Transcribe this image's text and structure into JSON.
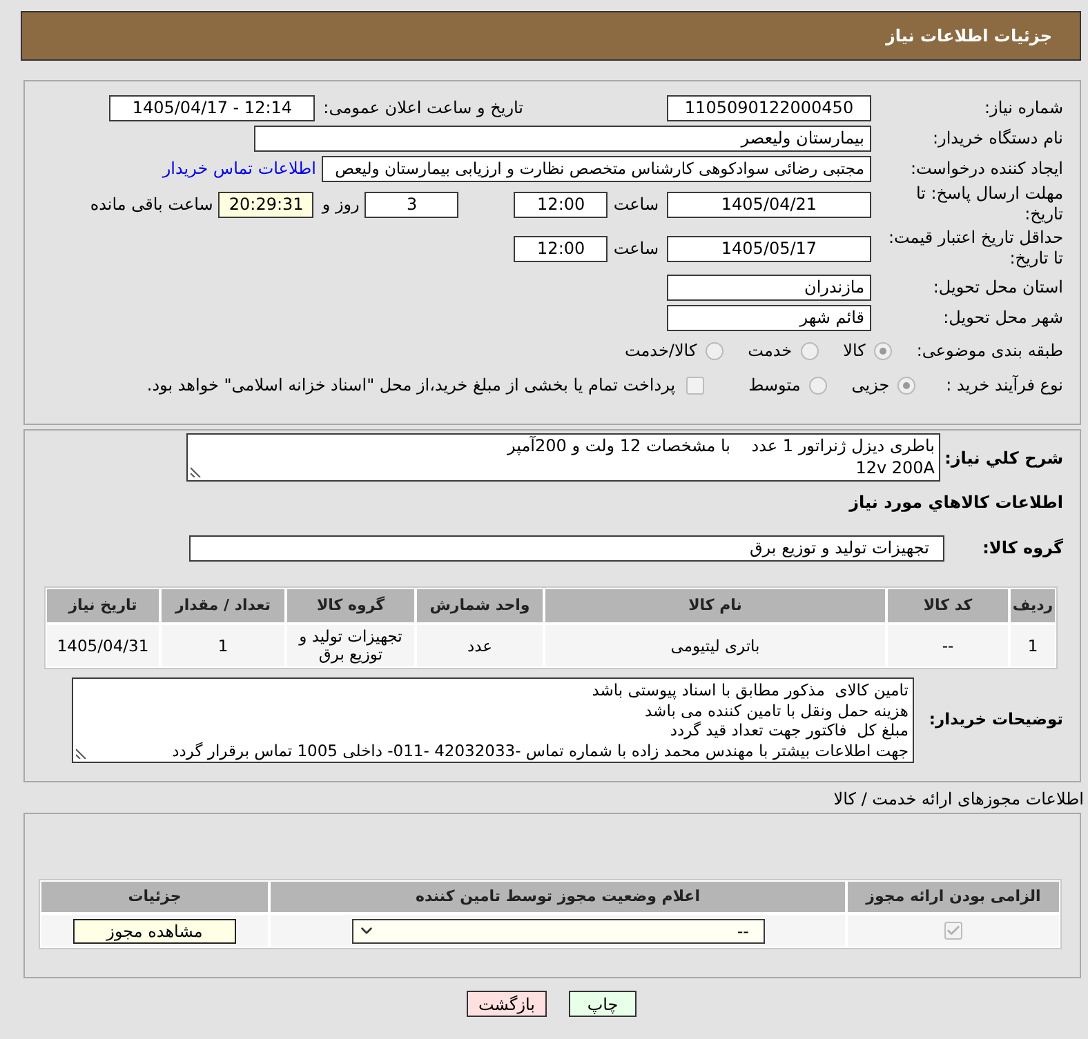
{
  "header": {
    "title": "جزئیات اطلاعات نیاز"
  },
  "need_details": {
    "need_number": {
      "label": "شماره نیاز:",
      "value": "1105090122000450"
    },
    "announcement": {
      "label": "تاریخ و ساعت اعلان عمومی:",
      "value": "1405/04/17 - 12:14"
    },
    "buyer_org": {
      "label": "نام دستگاه خریدار:",
      "value": "بیمارستان ولیعصر"
    },
    "requester": {
      "label": "ایجاد کننده درخواست:",
      "value": "مجتبی رضائی سوادکوهی کارشناس متخصص نظارت و ارزیابی بیمارستان ولیعص",
      "contact_link": "اطلاعات تماس خریدار"
    },
    "response_deadline": {
      "label": "مهلت ارسال پاسخ: تا تاریخ:",
      "date": "1405/04/21",
      "time_label": "ساعت",
      "time": "12:00",
      "days": "3",
      "days_label": "روز و",
      "remaining": "20:29:31",
      "remaining_label": "ساعت باقی مانده"
    },
    "price_validity": {
      "label": "حداقل تاریخ اعتبار قیمت: تا تاریخ:",
      "date": "1405/05/17",
      "time_label": "ساعت",
      "time": "12:00"
    },
    "delivery_province": {
      "label": "استان محل تحویل:",
      "value": "مازندران"
    },
    "delivery_city": {
      "label": "شهر محل تحویل:",
      "value": "قائم شهر"
    },
    "subject_category": {
      "label": "طبقه بندی موضوعی:",
      "options": [
        {
          "label": "کالا",
          "selected": true
        },
        {
          "label": "خدمت",
          "selected": false
        },
        {
          "label": "کالا/خدمت",
          "selected": false
        }
      ]
    },
    "purchase_process": {
      "label": "نوع فرآیند خرید :",
      "options": [
        {
          "label": "جزیی",
          "selected": true
        },
        {
          "label": "متوسط",
          "selected": false
        }
      ],
      "treasury_option": {
        "label": "پرداخت تمام یا بخشی از مبلغ خرید،از محل \"اسناد خزانه اسلامی\" خواهد بود.",
        "checked": false
      }
    }
  },
  "goods": {
    "description": {
      "label": "شرح کلي نياز:",
      "lines": [
        "باطری دیزل ژنراتور 1 عدد    با مشخصات 12 ولت و 200آمپر",
        "12v 200A"
      ]
    },
    "section_title": "اطلاعات کالاهاي مورد نياز",
    "goods_group": {
      "label": "گروه کالا:",
      "value": "تجهیزات تولید و توزیع برق"
    },
    "table": {
      "columns": [
        "ردیف",
        "کد کالا",
        "نام کالا",
        "واحد شمارش",
        "گروه کالا",
        "تعداد / مقدار",
        "تاریخ نیاز"
      ],
      "rows": [
        [
          "1",
          "--",
          "باتری لیتیومی",
          "عدد",
          "تجهیزات تولید و توزیع برق",
          "1",
          "1405/04/31"
        ]
      ]
    },
    "buyer_notes": {
      "label": "توضیحات خریدار:",
      "lines": [
        "تامین کالای  مذکور مطابق با اسناد پیوستی باشد",
        "هزینه حمل ونقل با تامین کننده می باشد",
        "مبلغ کل  فاکتور جهت تعداد قید گردد",
        "جهت اطلاعات بیشتر با مهندس محمد زاده با شماره تماس -42032033 -011- داخلی 1005 تماس برقرار گردد"
      ]
    }
  },
  "licenses": {
    "title": "اطلاعات مجوزهای ارائه خدمت / کالا",
    "columns": [
      "الزامی بودن ارائه مجوز",
      "اعلام وضعیت مجوز توسط تامین کننده",
      "جزئیات"
    ],
    "rows": [
      {
        "required": true,
        "status": "--",
        "details_button": "مشاهده مجوز"
      }
    ]
  },
  "buttons": [
    {
      "label": "چاپ",
      "kind": "print"
    },
    {
      "label": "بازگشت",
      "kind": "back"
    }
  ]
}
